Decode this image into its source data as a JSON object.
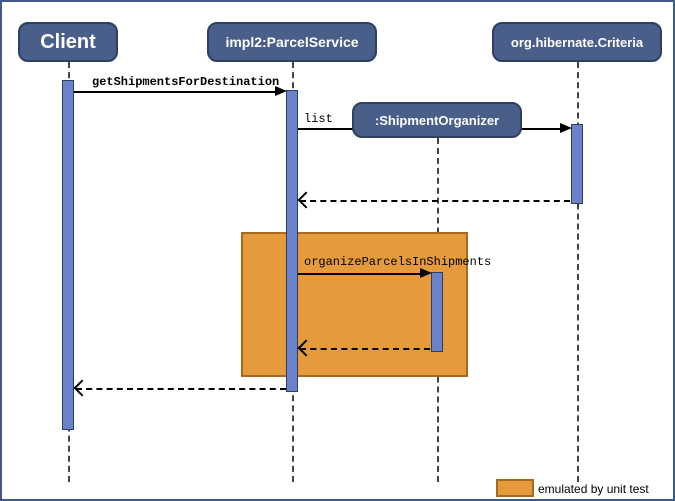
{
  "participants": {
    "client": {
      "label": "Client"
    },
    "service": {
      "label": "impl2:ParcelService"
    },
    "organizer": {
      "label": ":ShipmentOrganizer"
    },
    "criteria": {
      "label": "org.hibernate.Criteria"
    }
  },
  "messages": {
    "m1": {
      "label": "getShipmentsForDestination"
    },
    "m2": {
      "label": "list"
    },
    "m3": {
      "label": "organizeParcelsInShipments"
    }
  },
  "fragment": {
    "legend": "emulated by unit test"
  }
}
